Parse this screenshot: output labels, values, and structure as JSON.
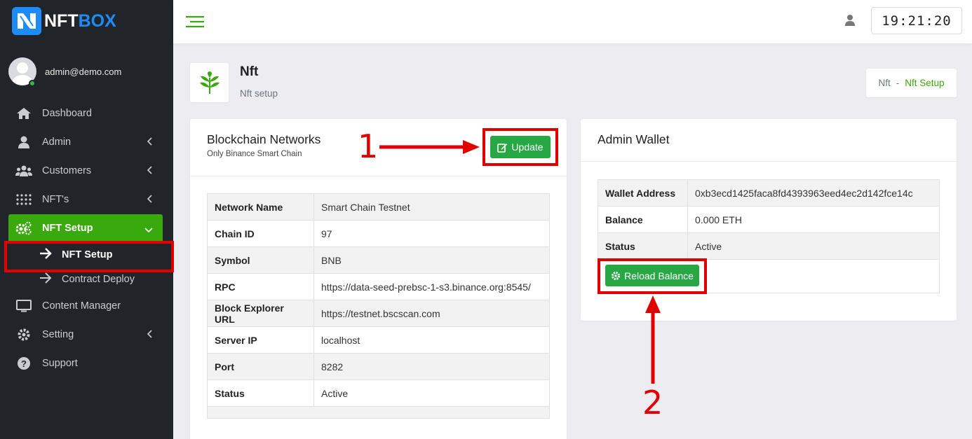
{
  "brand": {
    "part1": "NFT",
    "part2": "BOX",
    "accent": "#1d8cf8"
  },
  "user": {
    "email": "admin@demo.com"
  },
  "sidebar": {
    "items": [
      {
        "label": "Dashboard",
        "icon": "home-icon"
      },
      {
        "label": "Admin",
        "icon": "user-icon"
      },
      {
        "label": "Customers",
        "icon": "users-icon"
      },
      {
        "label": "NFT's",
        "icon": "grid-dots-icon"
      },
      {
        "label": "NFT Setup",
        "icon": "gears-icon"
      },
      {
        "label": "Content Manager",
        "icon": "monitor-icon"
      },
      {
        "label": "Setting",
        "icon": "gear-icon"
      },
      {
        "label": "Support",
        "icon": "question-icon"
      }
    ],
    "subitems": [
      {
        "label": "NFT Setup"
      },
      {
        "label": "Contract Deploy"
      }
    ],
    "active_color": "#39a90e"
  },
  "topbar": {
    "clock": "19:21:20"
  },
  "page": {
    "title": "Nft",
    "subtitle": "Nft setup"
  },
  "breadcrumb": {
    "parent": "Nft",
    "separator": "-",
    "current": "Nft Setup"
  },
  "blockchain": {
    "title": "Blockchain Networks",
    "subtitle": "Only Binance Smart Chain",
    "update_label": "Update",
    "rows": [
      {
        "key": "Network Name",
        "value": "Smart Chain Testnet"
      },
      {
        "key": "Chain ID",
        "value": "97"
      },
      {
        "key": "Symbol",
        "value": "BNB"
      },
      {
        "key": "RPC",
        "value": "https://data-seed-prebsc-1-s3.binance.org:8545/"
      },
      {
        "key": "Block Explorer URL",
        "value": "https://testnet.bscscan.com"
      },
      {
        "key": "Server IP",
        "value": "localhost"
      },
      {
        "key": "Port",
        "value": "8282"
      },
      {
        "key": "Status",
        "value": "Active"
      }
    ]
  },
  "wallet": {
    "title": "Admin Wallet",
    "rows": [
      {
        "key": "Wallet Address",
        "value": "0xb3ecd1425faca8fd4393963eed4ec2d142fce14c"
      },
      {
        "key": "Balance",
        "value": "0.000 ETH"
      },
      {
        "key": "Status",
        "value": "Active"
      }
    ],
    "reload_label": "Reload Balance"
  },
  "annotations": {
    "one": "1",
    "two": "2",
    "color": "#e10000"
  }
}
